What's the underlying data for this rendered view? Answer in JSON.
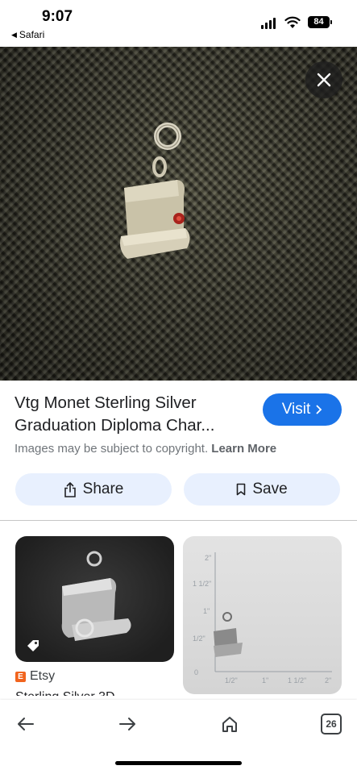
{
  "status_bar": {
    "time": "9:07",
    "back_app": "Safari",
    "battery": "84"
  },
  "result": {
    "title_line1": "Vtg Monet Sterling Silver",
    "title_line2": "Graduation Diploma Char...",
    "visit_label": "Visit",
    "copyright_text": "Images may be subject to copyright.",
    "learn_more": "Learn More",
    "share_label": "Share",
    "save_label": "Save"
  },
  "related": [
    {
      "source": "Etsy",
      "subtitle": "Sterling Silver 3D"
    },
    {
      "ruler_labels": [
        "2\"",
        "1 1/2\"",
        "1\"",
        "1/2\"",
        "0",
        "1/2\"",
        "1\"",
        "1 1/2\"",
        "2\""
      ]
    }
  ],
  "bottom_nav": {
    "tab_count": "26"
  },
  "colors": {
    "accent": "#1a73e8",
    "pill_bg": "#e8f0fe",
    "etsy": "#f1641e"
  },
  "icons": [
    "close-icon",
    "share-icon",
    "bookmark-icon",
    "chevron-right-icon",
    "back-arrow-icon",
    "forward-arrow-icon",
    "home-icon",
    "tabs-icon",
    "tag-icon"
  ]
}
